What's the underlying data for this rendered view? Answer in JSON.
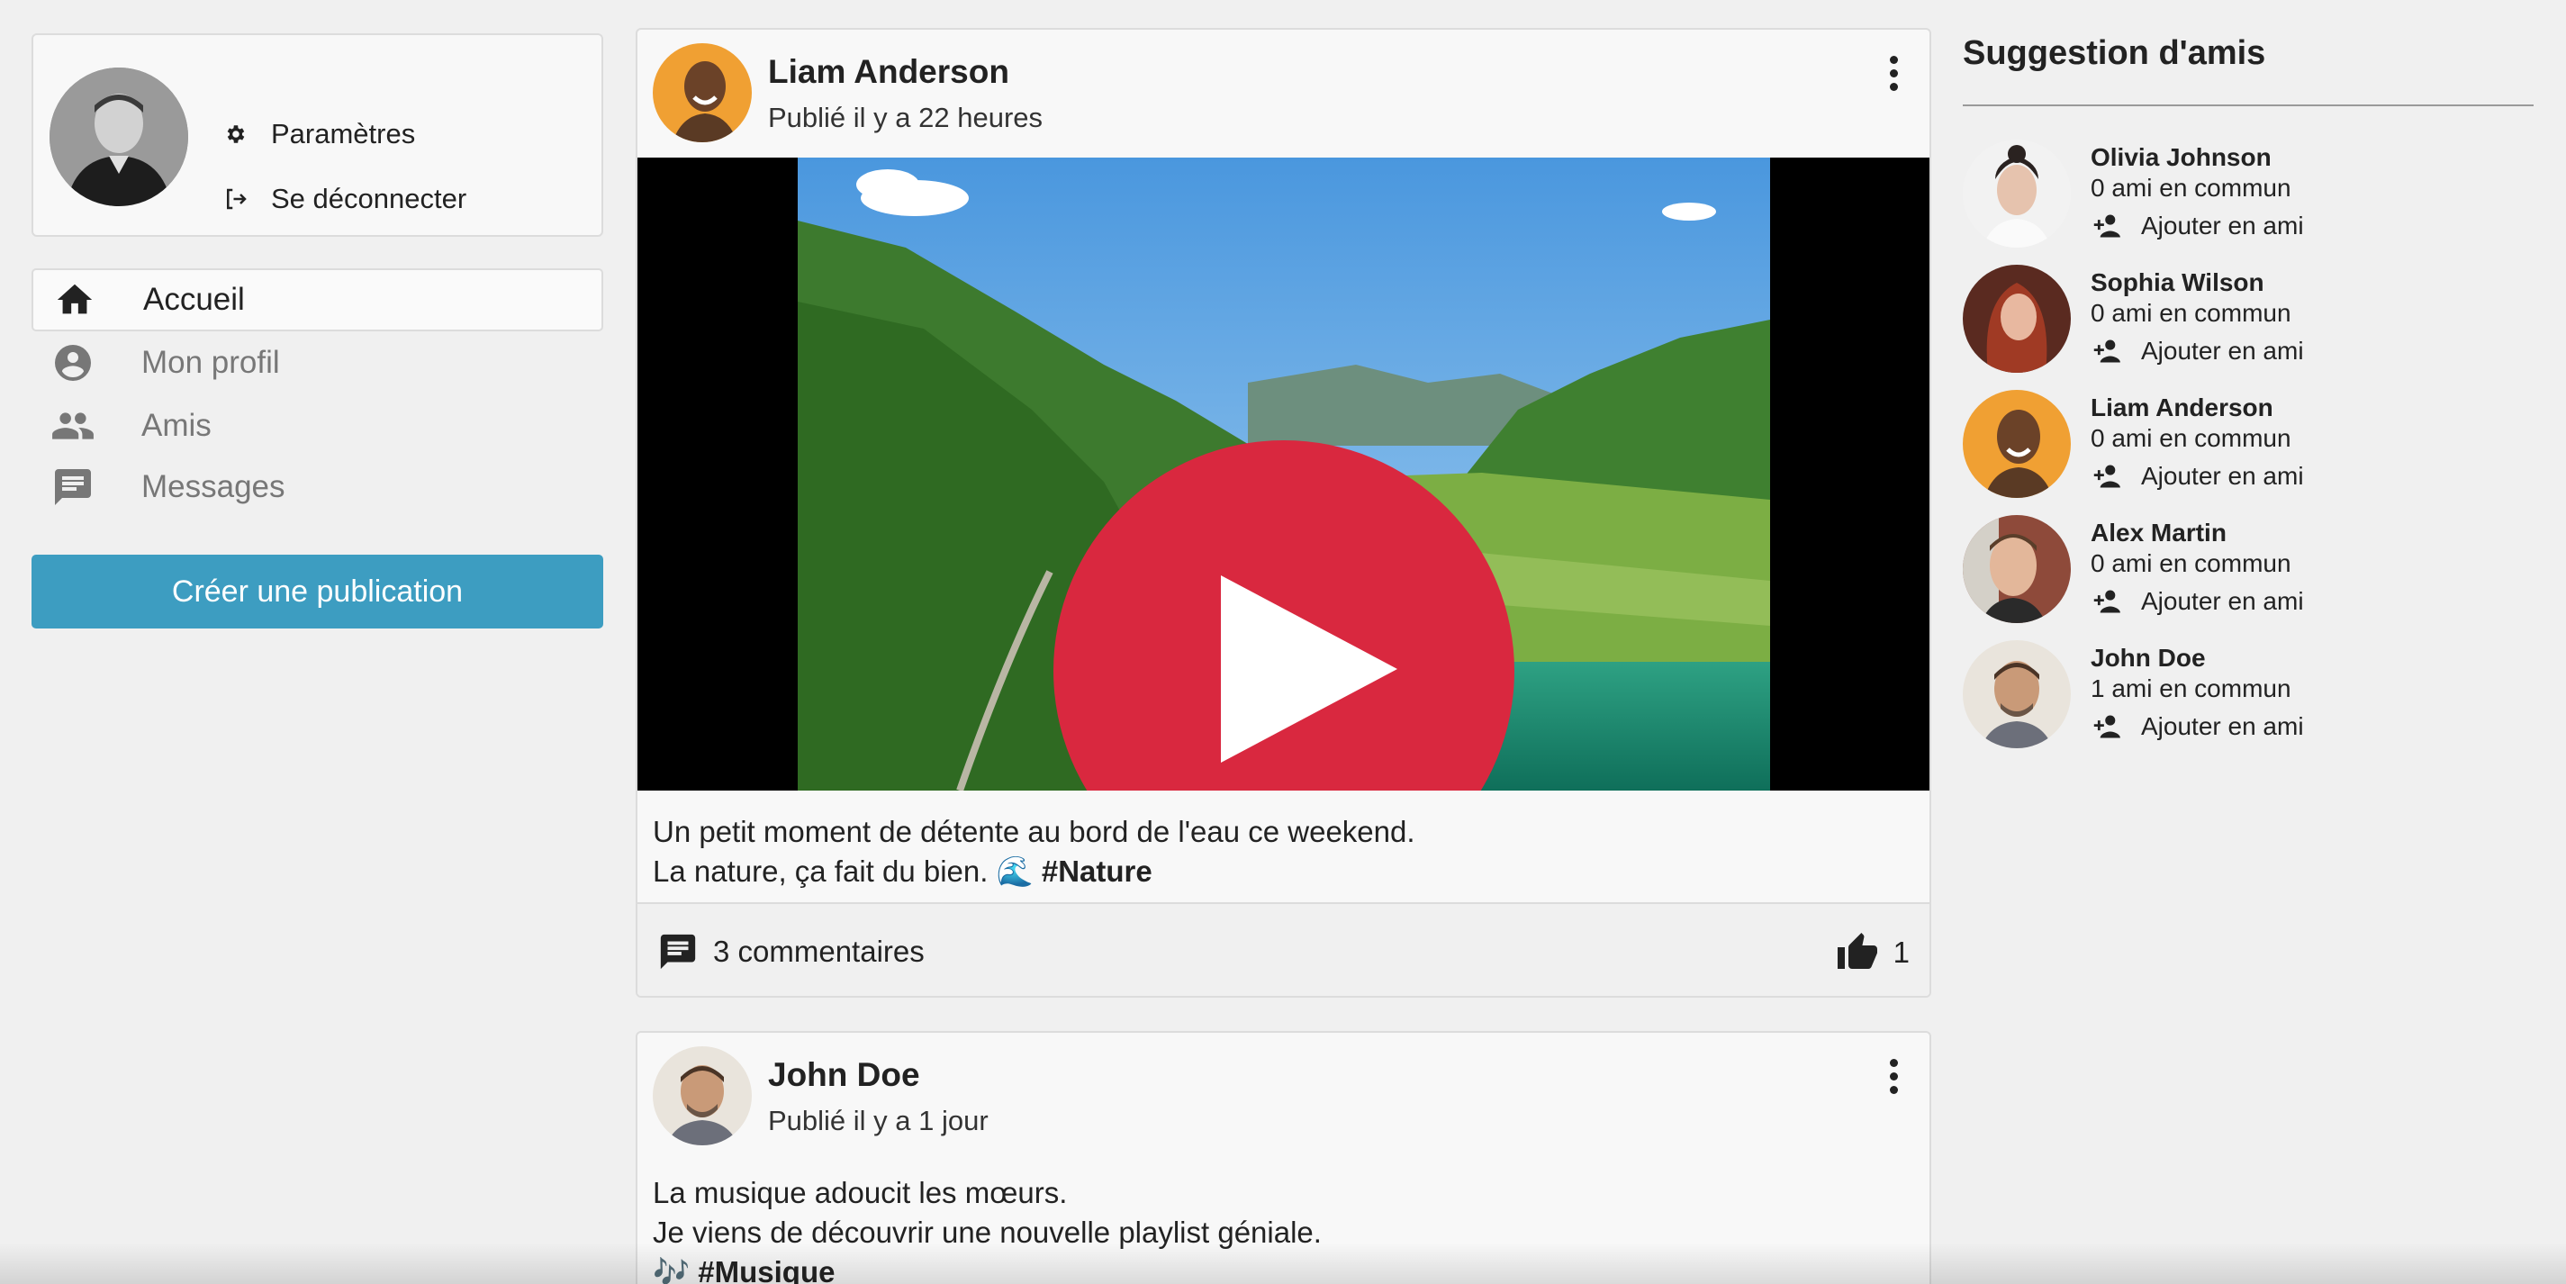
{
  "sidebar": {
    "profile_links": [
      {
        "label": "Paramètres",
        "icon": "gear-icon"
      },
      {
        "label": "Se déconnecter",
        "icon": "logout-icon"
      }
    ],
    "nav": [
      {
        "label": "Accueil",
        "icon": "home-icon",
        "active": true
      },
      {
        "label": "Mon profil",
        "icon": "account-circle-icon",
        "active": false
      },
      {
        "label": "Amis",
        "icon": "people-icon",
        "active": false
      },
      {
        "label": "Messages",
        "icon": "message-icon",
        "active": false
      }
    ],
    "create_button": "Créer une publication"
  },
  "feed": {
    "posts": [
      {
        "author": "Liam Anderson",
        "time": "Publié il y a 22 heures",
        "text_line1": "Un petit moment de détente au bord de l'eau ce weekend.",
        "text_line2": "La nature, ça fait du bien. 🌊",
        "hashtag": "#Nature",
        "comments": "3 commentaires",
        "likes": "1"
      },
      {
        "author": "John Doe",
        "time": "Publié il y a 1 jour",
        "text_line1": "La musique adoucit les mœurs.",
        "text_line2": "Je viens de découvrir une nouvelle playlist géniale.",
        "text_line3_prefix": "🎶",
        "hashtag": "#Musique"
      }
    ]
  },
  "suggestions": {
    "title": "Suggestion d'amis",
    "add_label": "Ajouter en ami",
    "items": [
      {
        "name": "Olivia Johnson",
        "mutual": "0 ami en commun"
      },
      {
        "name": "Sophia Wilson",
        "mutual": "0 ami en commun"
      },
      {
        "name": "Liam Anderson",
        "mutual": "0 ami en commun"
      },
      {
        "name": "Alex Martin",
        "mutual": "0 ami en commun"
      },
      {
        "name": "John Doe",
        "mutual": "1 ami en commun"
      }
    ]
  },
  "colors": {
    "primary_button": "#3d9dc1",
    "play_button": "#d9283f",
    "background": "#f0f0f0"
  }
}
